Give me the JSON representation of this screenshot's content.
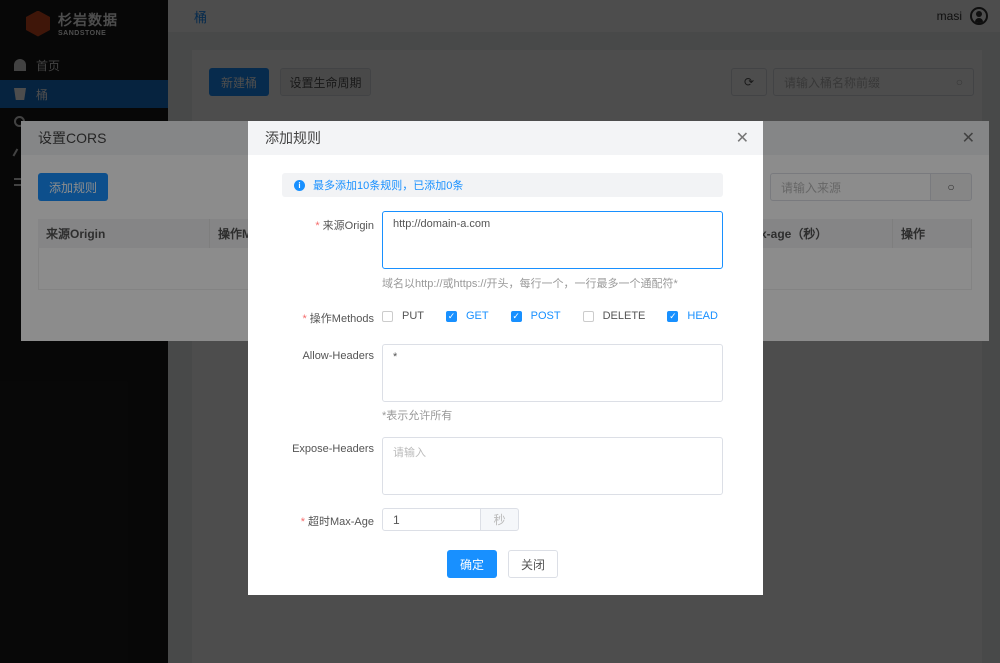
{
  "sidebar": {
    "brand": "杉岩数据",
    "brand_sub": "SANDSTONE",
    "items": [
      {
        "label": "首页",
        "icon": "dashboard-icon"
      },
      {
        "label": "桶",
        "icon": "bucket-icon",
        "active": true
      }
    ]
  },
  "header": {
    "breadcrumb": "桶",
    "username": "masi"
  },
  "toolbar": {
    "new_bucket": "新建桶",
    "lifecycle": "设置生命周期",
    "search_placeholder": "请输入桶名称前缀"
  },
  "cors_dialog": {
    "title": "设置CORS",
    "add_rule": "添加规则",
    "search_placeholder": "请输入来源",
    "columns": [
      "来源Origin",
      "操作M",
      "x-age（秒）",
      "操作"
    ]
  },
  "rule_dialog": {
    "title": "添加规则",
    "alert": "最多添加10条规则，已添加0条",
    "origin_label": "来源Origin",
    "origin_value": "http://domain-a.com",
    "origin_hint": "域名以http://或https://开头，每行一个，一行最多一个通配符*",
    "methods_label": "操作Methods",
    "methods": [
      {
        "label": "PUT",
        "checked": false
      },
      {
        "label": "GET",
        "checked": true
      },
      {
        "label": "POST",
        "checked": true
      },
      {
        "label": "DELETE",
        "checked": false
      },
      {
        "label": "HEAD",
        "checked": true
      }
    ],
    "allow_headers_label": "Allow-Headers",
    "allow_headers_value": "*",
    "allow_headers_hint": "*表示允许所有",
    "expose_headers_label": "Expose-Headers",
    "expose_headers_placeholder": "请输入",
    "max_age_label": "超时Max-Age",
    "max_age_value": "1",
    "max_age_unit": "秒",
    "ok": "确定",
    "cancel": "关闭"
  },
  "colors": {
    "primary": "#1890ff",
    "sidebar": "#1a1a1a",
    "required": "#f56c6c"
  }
}
